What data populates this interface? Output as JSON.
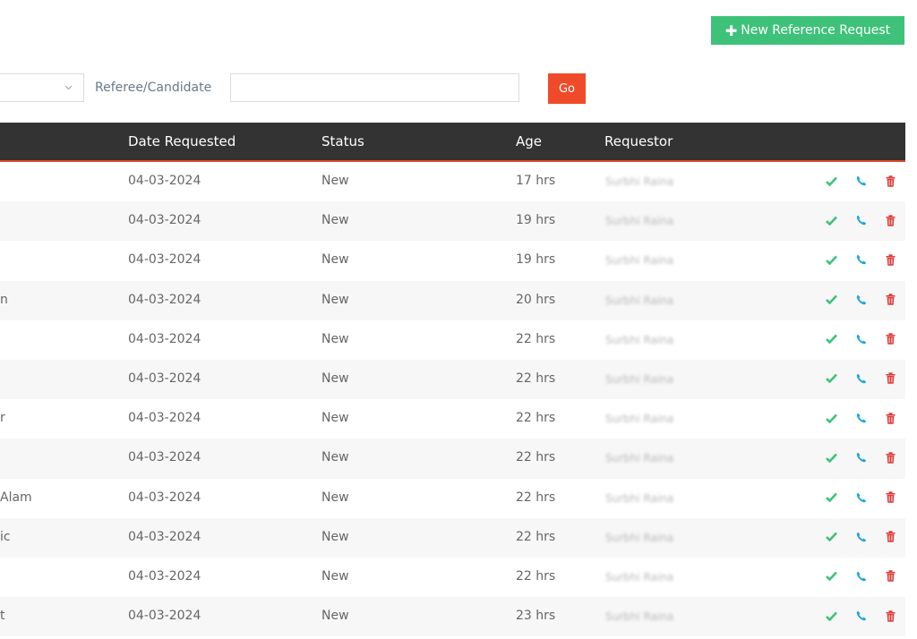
{
  "toolbar": {
    "new_request_label": "New Reference Request",
    "filter_label": "Referee/Candidate",
    "search_value": "",
    "go_label": "Go"
  },
  "table": {
    "headers": {
      "date": "Date Requested",
      "status": "Status",
      "age": "Age",
      "requestor": "Requestor"
    },
    "rows": [
      {
        "name": "",
        "date": "04-03-2024",
        "status": "New",
        "age": "17 hrs",
        "requestor": "Surbhi Raina"
      },
      {
        "name": "",
        "date": "04-03-2024",
        "status": "New",
        "age": "19 hrs",
        "requestor": "Surbhi Raina"
      },
      {
        "name": "",
        "date": "04-03-2024",
        "status": "New",
        "age": "19 hrs",
        "requestor": "Surbhi Raina"
      },
      {
        "name": "n",
        "date": "04-03-2024",
        "status": "New",
        "age": "20 hrs",
        "requestor": "Surbhi Raina"
      },
      {
        "name": "",
        "date": "04-03-2024",
        "status": "New",
        "age": "22 hrs",
        "requestor": "Surbhi Raina"
      },
      {
        "name": "",
        "date": "04-03-2024",
        "status": "New",
        "age": "22 hrs",
        "requestor": "Surbhi Raina"
      },
      {
        "name": "r",
        "date": "04-03-2024",
        "status": "New",
        "age": "22 hrs",
        "requestor": "Surbhi Raina"
      },
      {
        "name": "",
        "date": "04-03-2024",
        "status": "New",
        "age": "22 hrs",
        "requestor": "Surbhi Raina"
      },
      {
        "name": "Alam",
        "date": "04-03-2024",
        "status": "New",
        "age": "22 hrs",
        "requestor": "Surbhi Raina"
      },
      {
        "name": "ic",
        "date": "04-03-2024",
        "status": "New",
        "age": "22 hrs",
        "requestor": "Surbhi Raina"
      },
      {
        "name": "",
        "date": "04-03-2024",
        "status": "New",
        "age": "22 hrs",
        "requestor": "Surbhi Raina"
      },
      {
        "name": "t",
        "date": "04-03-2024",
        "status": "New",
        "age": "23 hrs",
        "requestor": "Surbhi Raina"
      }
    ]
  },
  "colors": {
    "new_button": "#3ec279",
    "go_button": "#ef4b2b",
    "header_bg": "#333333",
    "header_accent": "#e04a2d",
    "check_icon": "#3ec279",
    "phone_icon": "#21a6d9",
    "trash_icon": "#e03b3b"
  },
  "icons": {
    "new_button": "plus-icon",
    "row_actions": [
      "check-icon",
      "phone-icon",
      "trash-icon"
    ]
  }
}
